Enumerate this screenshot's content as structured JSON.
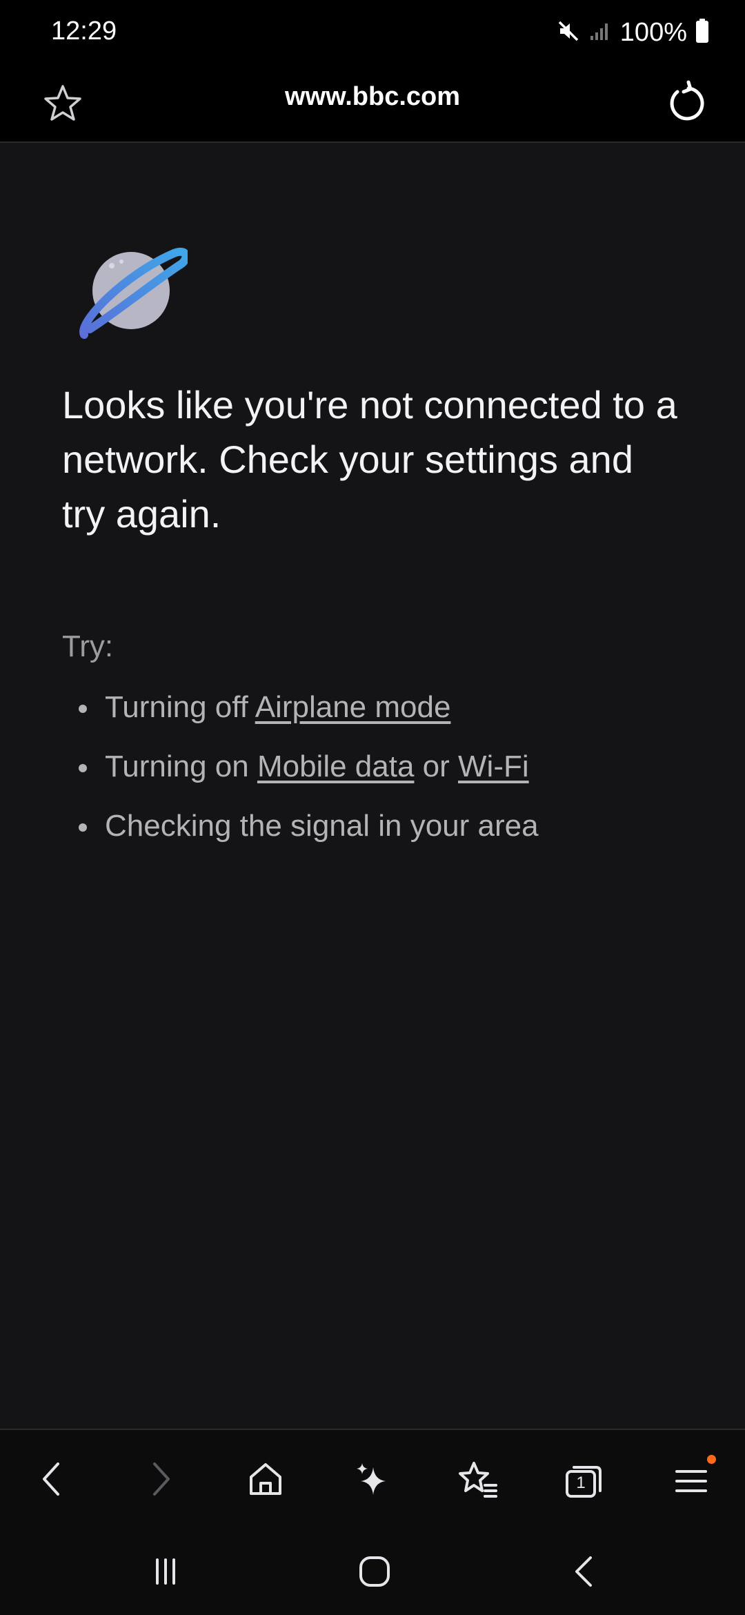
{
  "status_bar": {
    "time": "12:29",
    "battery_percent": "100%",
    "icons": [
      "mute-icon",
      "signal-icon",
      "battery-icon"
    ]
  },
  "browser_toolbar": {
    "url": "www.bbc.com",
    "icons": [
      "star-icon",
      "reload-icon"
    ]
  },
  "error_page": {
    "illustration": "planet-icon",
    "headline": "Looks like you're not connected to a network. Check your settings and try again.",
    "try_label": "Try:",
    "tips": [
      {
        "prefix": "Turning off ",
        "link": "Airplane mode"
      },
      {
        "prefix": "Turning on ",
        "link1": "Mobile data",
        "middle": " or ",
        "link2": "Wi-Fi"
      },
      {
        "text": "Checking the signal in your area"
      }
    ]
  },
  "bottom_toolbar": {
    "buttons": [
      "back-icon",
      "forward-icon",
      "home-icon",
      "sparkle-icon",
      "bookmarks-icon",
      "tabs-icon",
      "menu-icon"
    ],
    "tab_count": "1"
  },
  "system_nav": {
    "buttons": [
      "recents-icon",
      "home-icon",
      "back-icon"
    ]
  },
  "colors": {
    "background": "#141416",
    "bars": "#000000",
    "notification_dot": "#ff6a1a"
  }
}
